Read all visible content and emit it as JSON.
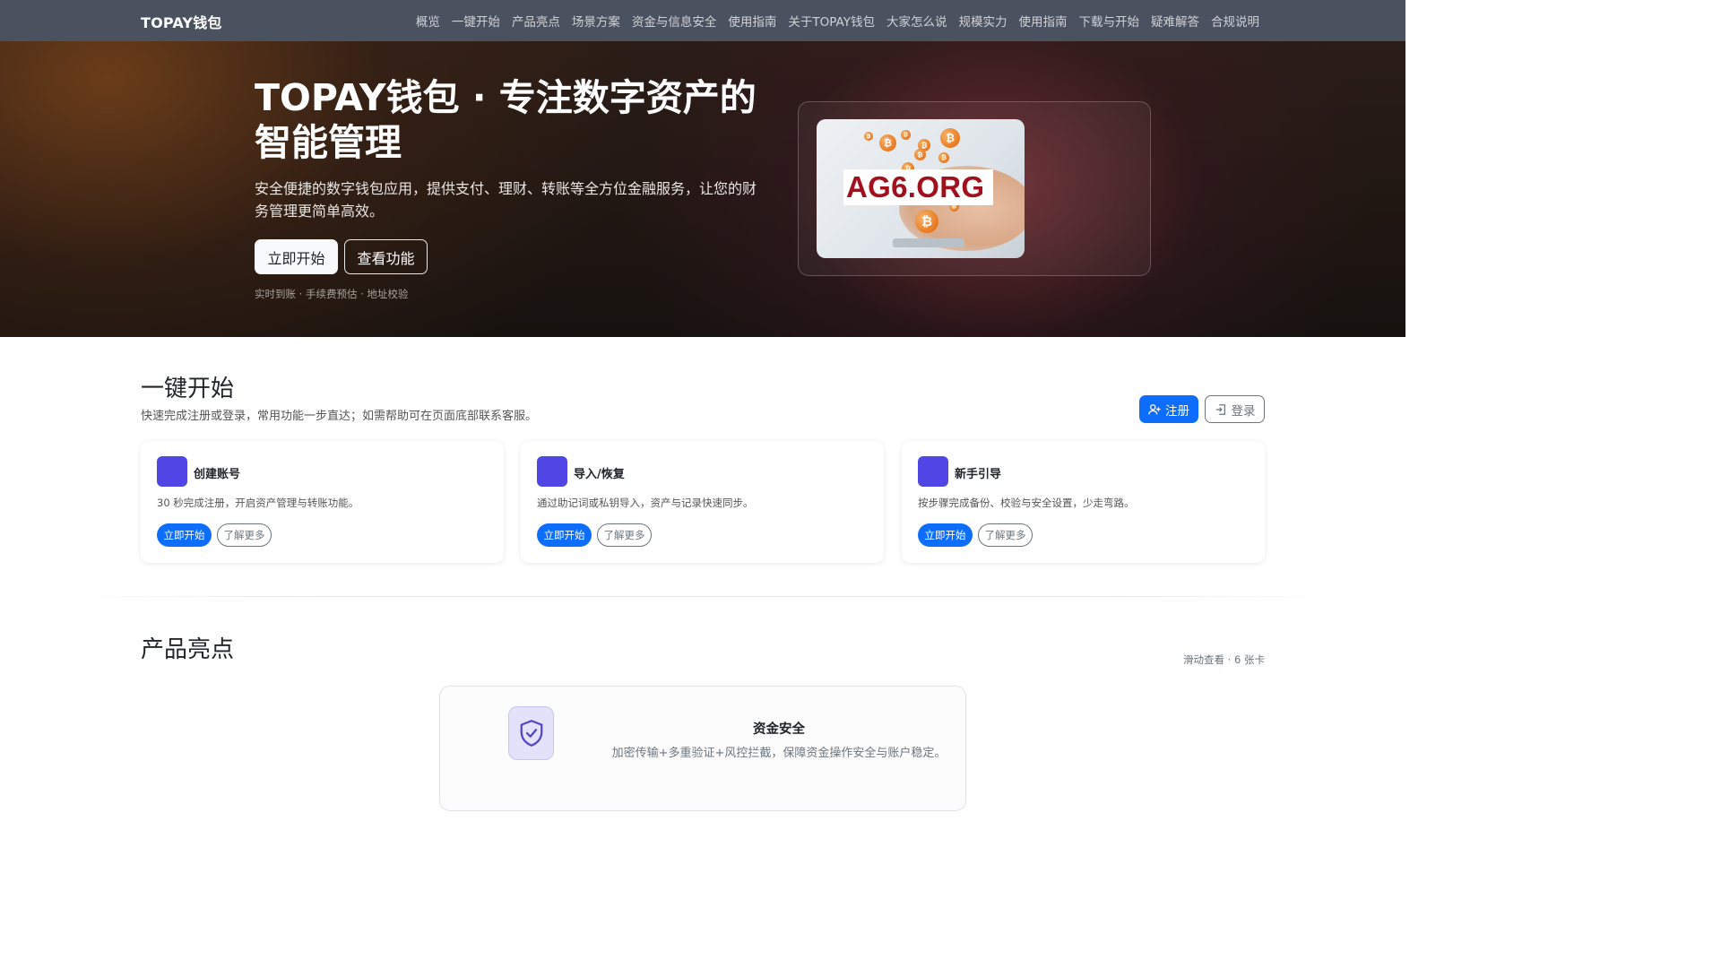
{
  "nav": {
    "brand": "TOPAY钱包",
    "links": [
      "概览",
      "一键开始",
      "产品亮点",
      "场景方案",
      "资金与信息安全",
      "使用指南",
      "关于TOPAY钱包",
      "大家怎么说",
      "规模实力",
      "使用指南",
      "下载与开始",
      "疑难解答",
      "合规说明"
    ]
  },
  "hero": {
    "title": "TOPAY钱包 · 专注数字资产的智能管理",
    "subtitle": "安全便捷的数字钱包应用，提供支付、理财、转账等全方位金融服务，让您的财务管理更简单高效。",
    "primary_button": "立即开始",
    "secondary_button": "查看功能",
    "tags": "实时到账 · 手续费预估 · 地址校验",
    "image_text": "AG6.ORG",
    "coin_symbol": "₿"
  },
  "quickstart": {
    "title": "一键开始",
    "subtitle": "快速完成注册或登录，常用功能一步直达；如需帮助可在页面底部联系客服。",
    "register_label": "注册",
    "login_label": "登录",
    "cards": [
      {
        "title": "创建账号",
        "desc": "30 秒完成注册，开启资产管理与转账功能。",
        "primary": "立即开始",
        "secondary": "了解更多"
      },
      {
        "title": "导入/恢复",
        "desc": "通过助记词或私钥导入，资产与记录快速同步。",
        "primary": "立即开始",
        "secondary": "了解更多"
      },
      {
        "title": "新手引导",
        "desc": "按步骤完成备份、校验与安全设置，少走弯路。",
        "primary": "立即开始",
        "secondary": "了解更多"
      }
    ]
  },
  "highlights": {
    "title": "产品亮点",
    "hint": "滑动查看 · 6 张卡",
    "feature": {
      "icon": "shield-check-icon",
      "title": "资金安全",
      "desc": "加密传输+多重验证+风控拦截，保障资金操作安全与账户稳定。"
    }
  },
  "colors": {
    "nav_bg": "#4a5260",
    "primary": "#0d6efd",
    "accent_square": "#5046e5",
    "brand_red": "#a0111d"
  }
}
